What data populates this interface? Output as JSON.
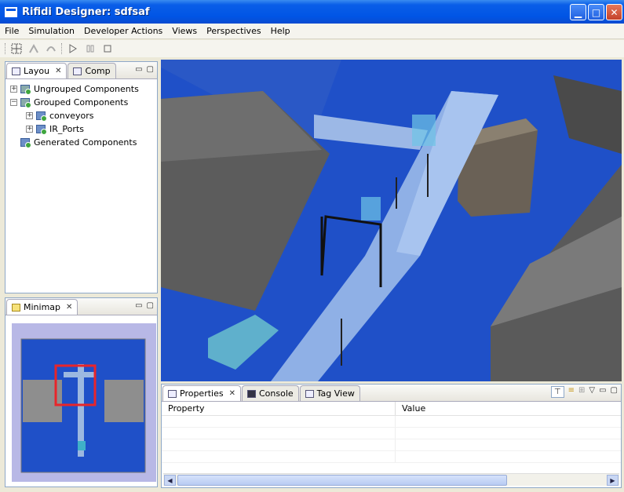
{
  "window": {
    "title": "Rifidi Designer: sdfsaf"
  },
  "menu": [
    "File",
    "Simulation",
    "Developer Actions",
    "Views",
    "Perspectives",
    "Help"
  ],
  "layout_panel": {
    "tabs": [
      {
        "label": "Layou"
      },
      {
        "label": "Comp"
      }
    ],
    "tree": {
      "ungrouped": "Ungrouped Components",
      "grouped": "Grouped Components",
      "conveyors": "conveyors",
      "ir_ports": "IR_Ports",
      "generated": "Generated Components"
    }
  },
  "minimap_panel": {
    "tab": "Minimap"
  },
  "bottom_panel": {
    "tabs": [
      {
        "label": "Properties"
      },
      {
        "label": "Console"
      },
      {
        "label": "Tag View"
      }
    ],
    "columns": [
      "Property",
      "Value"
    ]
  },
  "colors": {
    "title_blue": "#0055e5",
    "floor_blue": "#1f50c8",
    "minimap_red": "#e8252a"
  }
}
